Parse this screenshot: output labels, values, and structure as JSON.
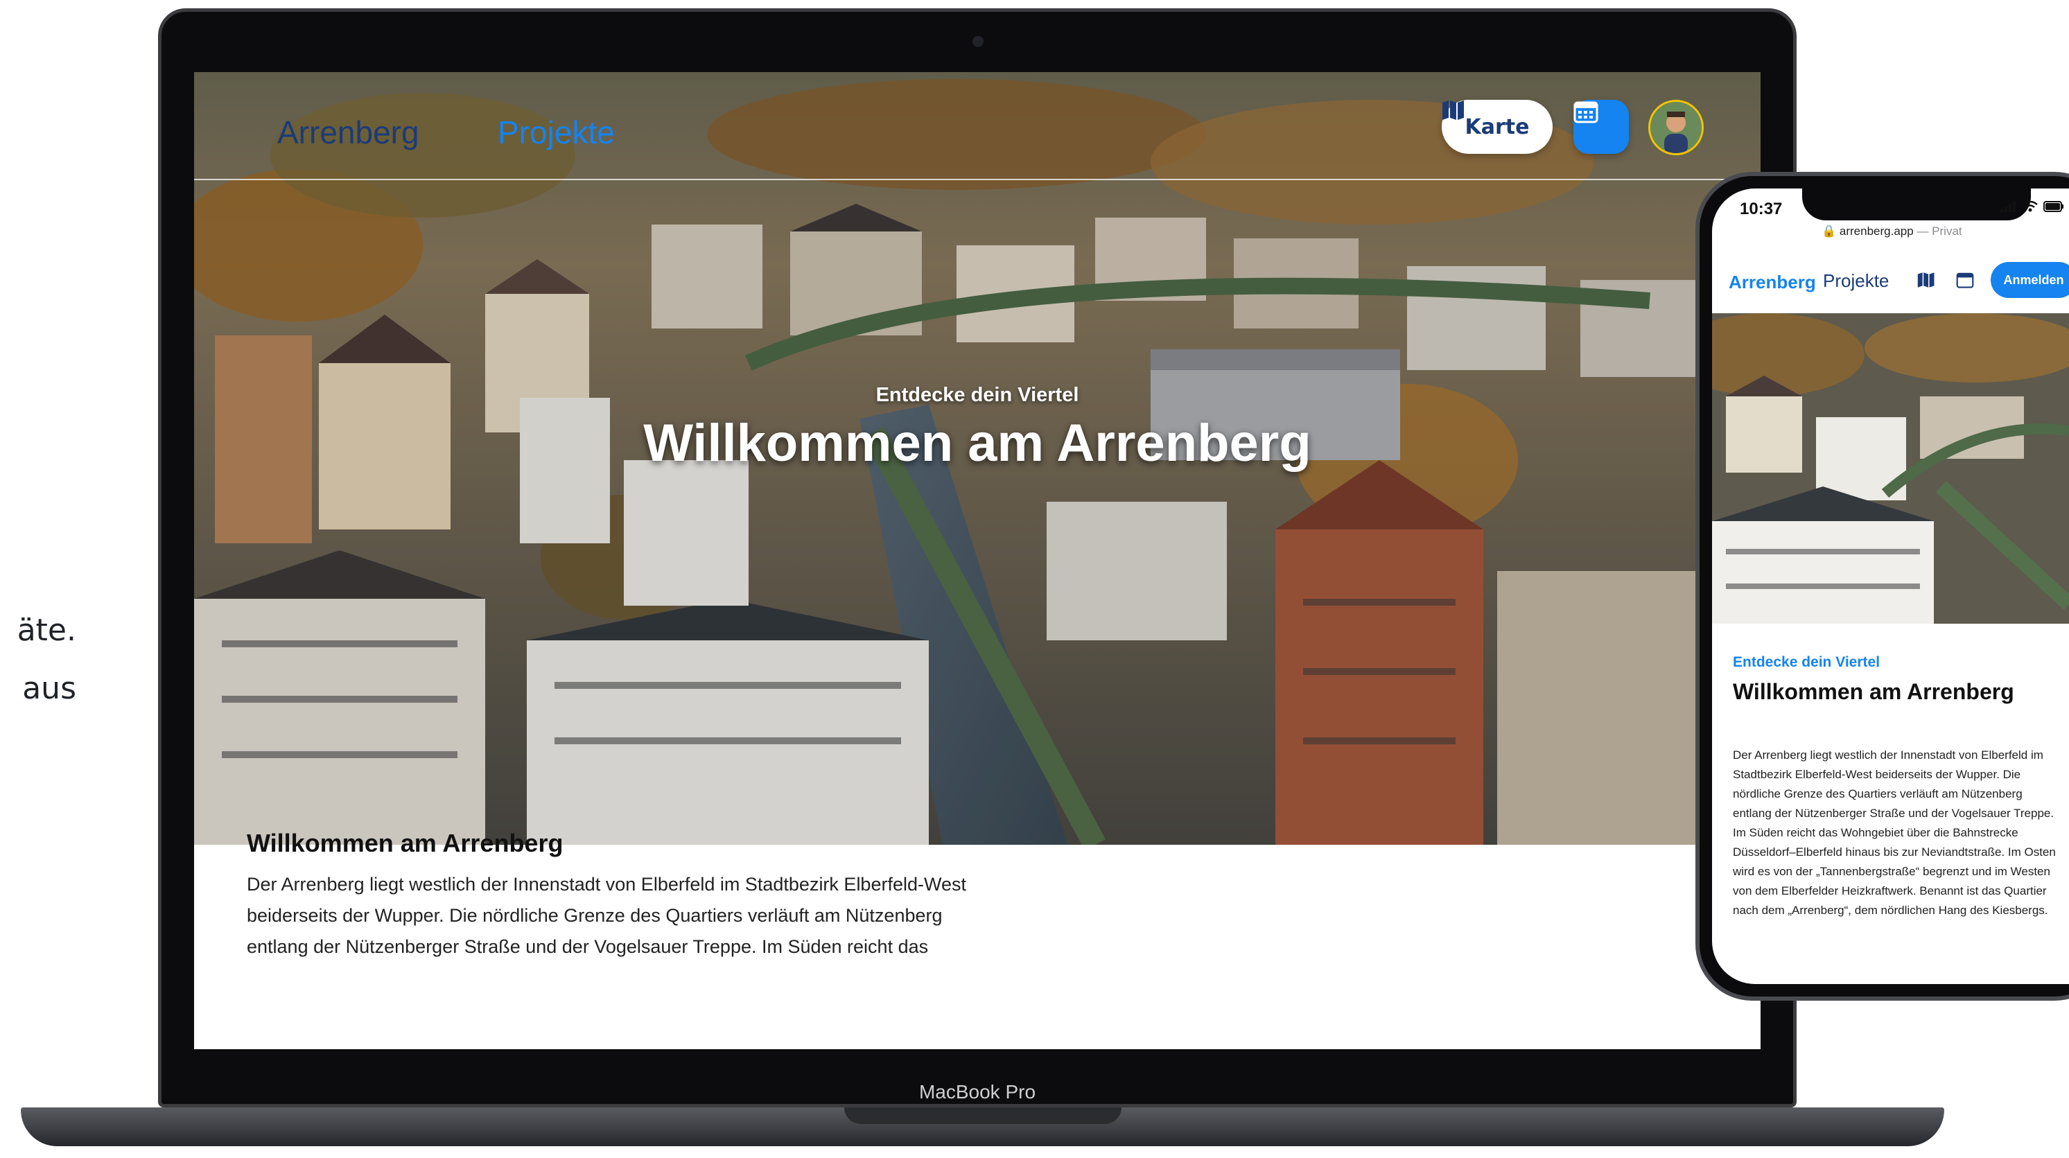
{
  "side_copy": {
    "line1": "äte.",
    "line2": "aus"
  },
  "laptop": {
    "model_label": "MacBook Pro",
    "nav": {
      "brand": "Arrenberg",
      "projects": "Projekte",
      "map_button": "Karte",
      "map_icon": "map-icon",
      "calendar_icon": "calendar-icon",
      "avatar": "user-avatar"
    },
    "hero": {
      "kicker": "Entdecke dein Viertel",
      "title": "Willkommen am Arrenberg"
    },
    "content": {
      "heading": "Willkommen am Arrenberg",
      "paragraph": "Der Arrenberg liegt westlich der Innenstadt von Elberfeld im Stadtbezirk Elberfeld-West beiderseits der Wupper. Die nördliche Grenze des Quartiers verläuft am Nützenberg entlang der Nützenberger Straße und der Vogelsauer Treppe. Im Süden reicht das"
    }
  },
  "phone": {
    "status": {
      "time": "10:37"
    },
    "browser": {
      "url": "arrenberg.app",
      "mode": "— Privat"
    },
    "nav": {
      "brand": "Arrenberg",
      "projects": "Projekte",
      "map_icon": "map-icon",
      "calendar_icon": "calendar-icon",
      "login": "Anmelden"
    },
    "kicker": "Entdecke dein Viertel",
    "title": "Willkommen am Arrenberg",
    "body": "Der Arrenberg liegt westlich der Innenstadt von Elberfeld im Stadtbezirk Elberfeld-West beiderseits der Wupper. Die nördliche Grenze des Quartiers verläuft am Nützenberg entlang der Nützenberger Straße und der Vogelsauer Treppe. Im Süden reicht das Wohngebiet über die Bahnstrecke Düsseldorf–Elberfeld hinaus bis zur Neviandtstraße. Im Osten wird es von der „Tannenbergstraße“ begrenzt und im Westen von dem Elberfelder Heizkraftwerk. Benannt ist das Quartier nach dem „Arrenberg“, dem nördlichen Hang des Kiesbergs."
  },
  "colors": {
    "brand_blue": "#1583f0",
    "brand_navy": "#1b3b78"
  }
}
